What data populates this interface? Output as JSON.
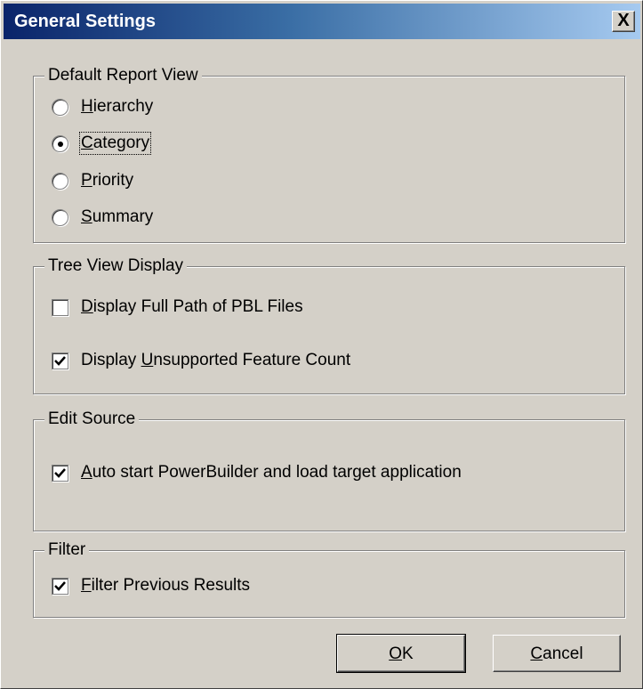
{
  "window": {
    "title": "General Settings",
    "close_glyph": "X"
  },
  "default_report_view": {
    "legend": "Default Report View",
    "options": [
      {
        "pre": "",
        "accel": "H",
        "post": "ierarchy",
        "selected": false
      },
      {
        "pre": "",
        "accel": "C",
        "post": "ategory",
        "selected": true
      },
      {
        "pre": "",
        "accel": "P",
        "post": "riority",
        "selected": false
      },
      {
        "pre": "",
        "accel": "S",
        "post": "ummary",
        "selected": false
      }
    ]
  },
  "tree_view_display": {
    "legend": "Tree View Display",
    "options": [
      {
        "pre": "",
        "accel": "D",
        "post": "isplay Full Path of PBL Files",
        "checked": false
      },
      {
        "pre": "Display ",
        "accel": "U",
        "post": "nsupported Feature Count",
        "checked": true
      }
    ]
  },
  "edit_source": {
    "legend": "Edit Source",
    "options": [
      {
        "pre": "",
        "accel": "A",
        "post": "uto start PowerBuilder and load target application",
        "checked": true
      }
    ]
  },
  "filter": {
    "legend": "Filter",
    "options": [
      {
        "pre": "",
        "accel": "F",
        "post": "ilter Previous Results",
        "checked": true
      }
    ]
  },
  "buttons": {
    "ok": {
      "accel": "O",
      "post": "K"
    },
    "cancel": {
      "accel": "C",
      "post": "ancel"
    }
  }
}
